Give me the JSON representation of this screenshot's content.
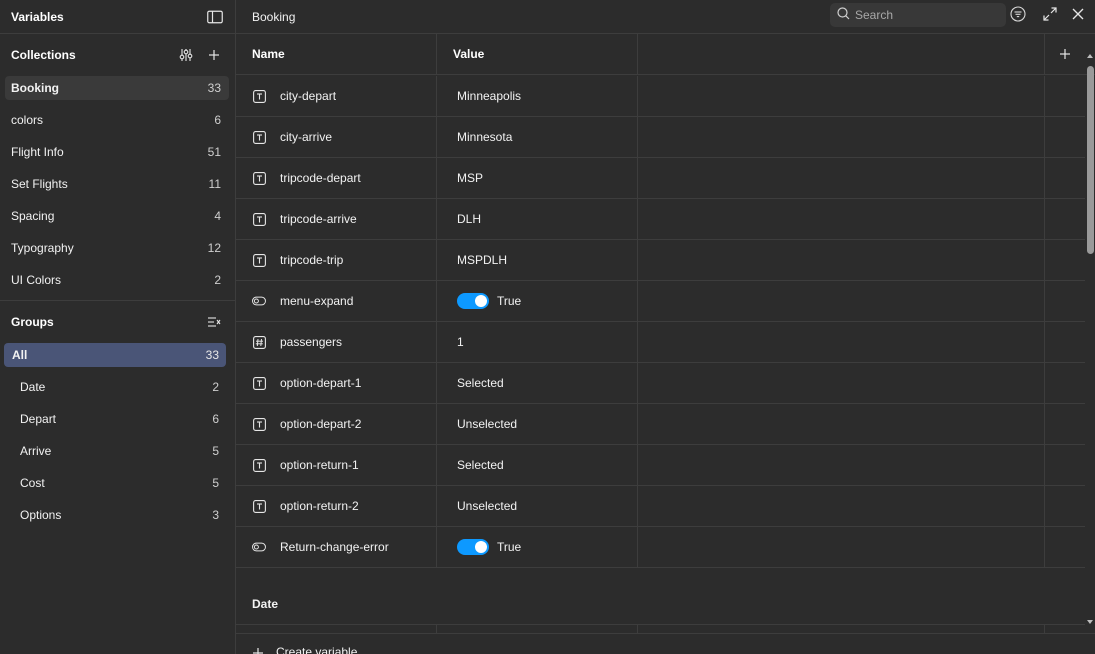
{
  "sidebar": {
    "title": "Variables",
    "collections_title": "Collections",
    "collections": [
      {
        "label": "Booking",
        "count": "33"
      },
      {
        "label": "colors",
        "count": "6"
      },
      {
        "label": "Flight Info",
        "count": "51"
      },
      {
        "label": "Set Flights",
        "count": "11"
      },
      {
        "label": "Spacing",
        "count": "4"
      },
      {
        "label": "Typography",
        "count": "12"
      },
      {
        "label": "UI Colors",
        "count": "2"
      }
    ],
    "groups_title": "Groups",
    "groups": [
      {
        "label": "All",
        "count": "33"
      },
      {
        "label": "Date",
        "count": "2"
      },
      {
        "label": "Depart",
        "count": "6"
      },
      {
        "label": "Arrive",
        "count": "5"
      },
      {
        "label": "Cost",
        "count": "5"
      },
      {
        "label": "Options",
        "count": "3"
      }
    ]
  },
  "main": {
    "title": "Booking",
    "search_placeholder": "Search",
    "columns": {
      "name": "Name",
      "value": "Value"
    },
    "rows": [
      {
        "type": "text-icon",
        "name": "city-depart",
        "value": "Minneapolis"
      },
      {
        "type": "text-icon",
        "name": "city-arrive",
        "value": "Minnesota"
      },
      {
        "type": "text-icon",
        "name": "tripcode-depart",
        "value": "MSP"
      },
      {
        "type": "text-icon",
        "name": "tripcode-arrive",
        "value": "DLH"
      },
      {
        "type": "text-icon",
        "name": "tripcode-trip",
        "value": "MSPDLH"
      },
      {
        "type": "boolean-icon",
        "name": "menu-expand",
        "value": "True"
      },
      {
        "type": "number-icon",
        "name": "passengers",
        "value": "1"
      },
      {
        "type": "text-icon",
        "name": "option-depart-1",
        "value": "Selected"
      },
      {
        "type": "text-icon",
        "name": "option-depart-2",
        "value": "Unselected"
      },
      {
        "type": "text-icon",
        "name": "option-return-1",
        "value": "Selected"
      },
      {
        "type": "text-icon",
        "name": "option-return-2",
        "value": "Unselected"
      },
      {
        "type": "boolean-icon",
        "name": "Return-change-error",
        "value": "True"
      }
    ],
    "group_label": "Date",
    "create_label": "Create variable"
  },
  "colors": {
    "accent": "#0d99ff",
    "selected_group": "#4a5577",
    "background": "#2c2c2c"
  }
}
